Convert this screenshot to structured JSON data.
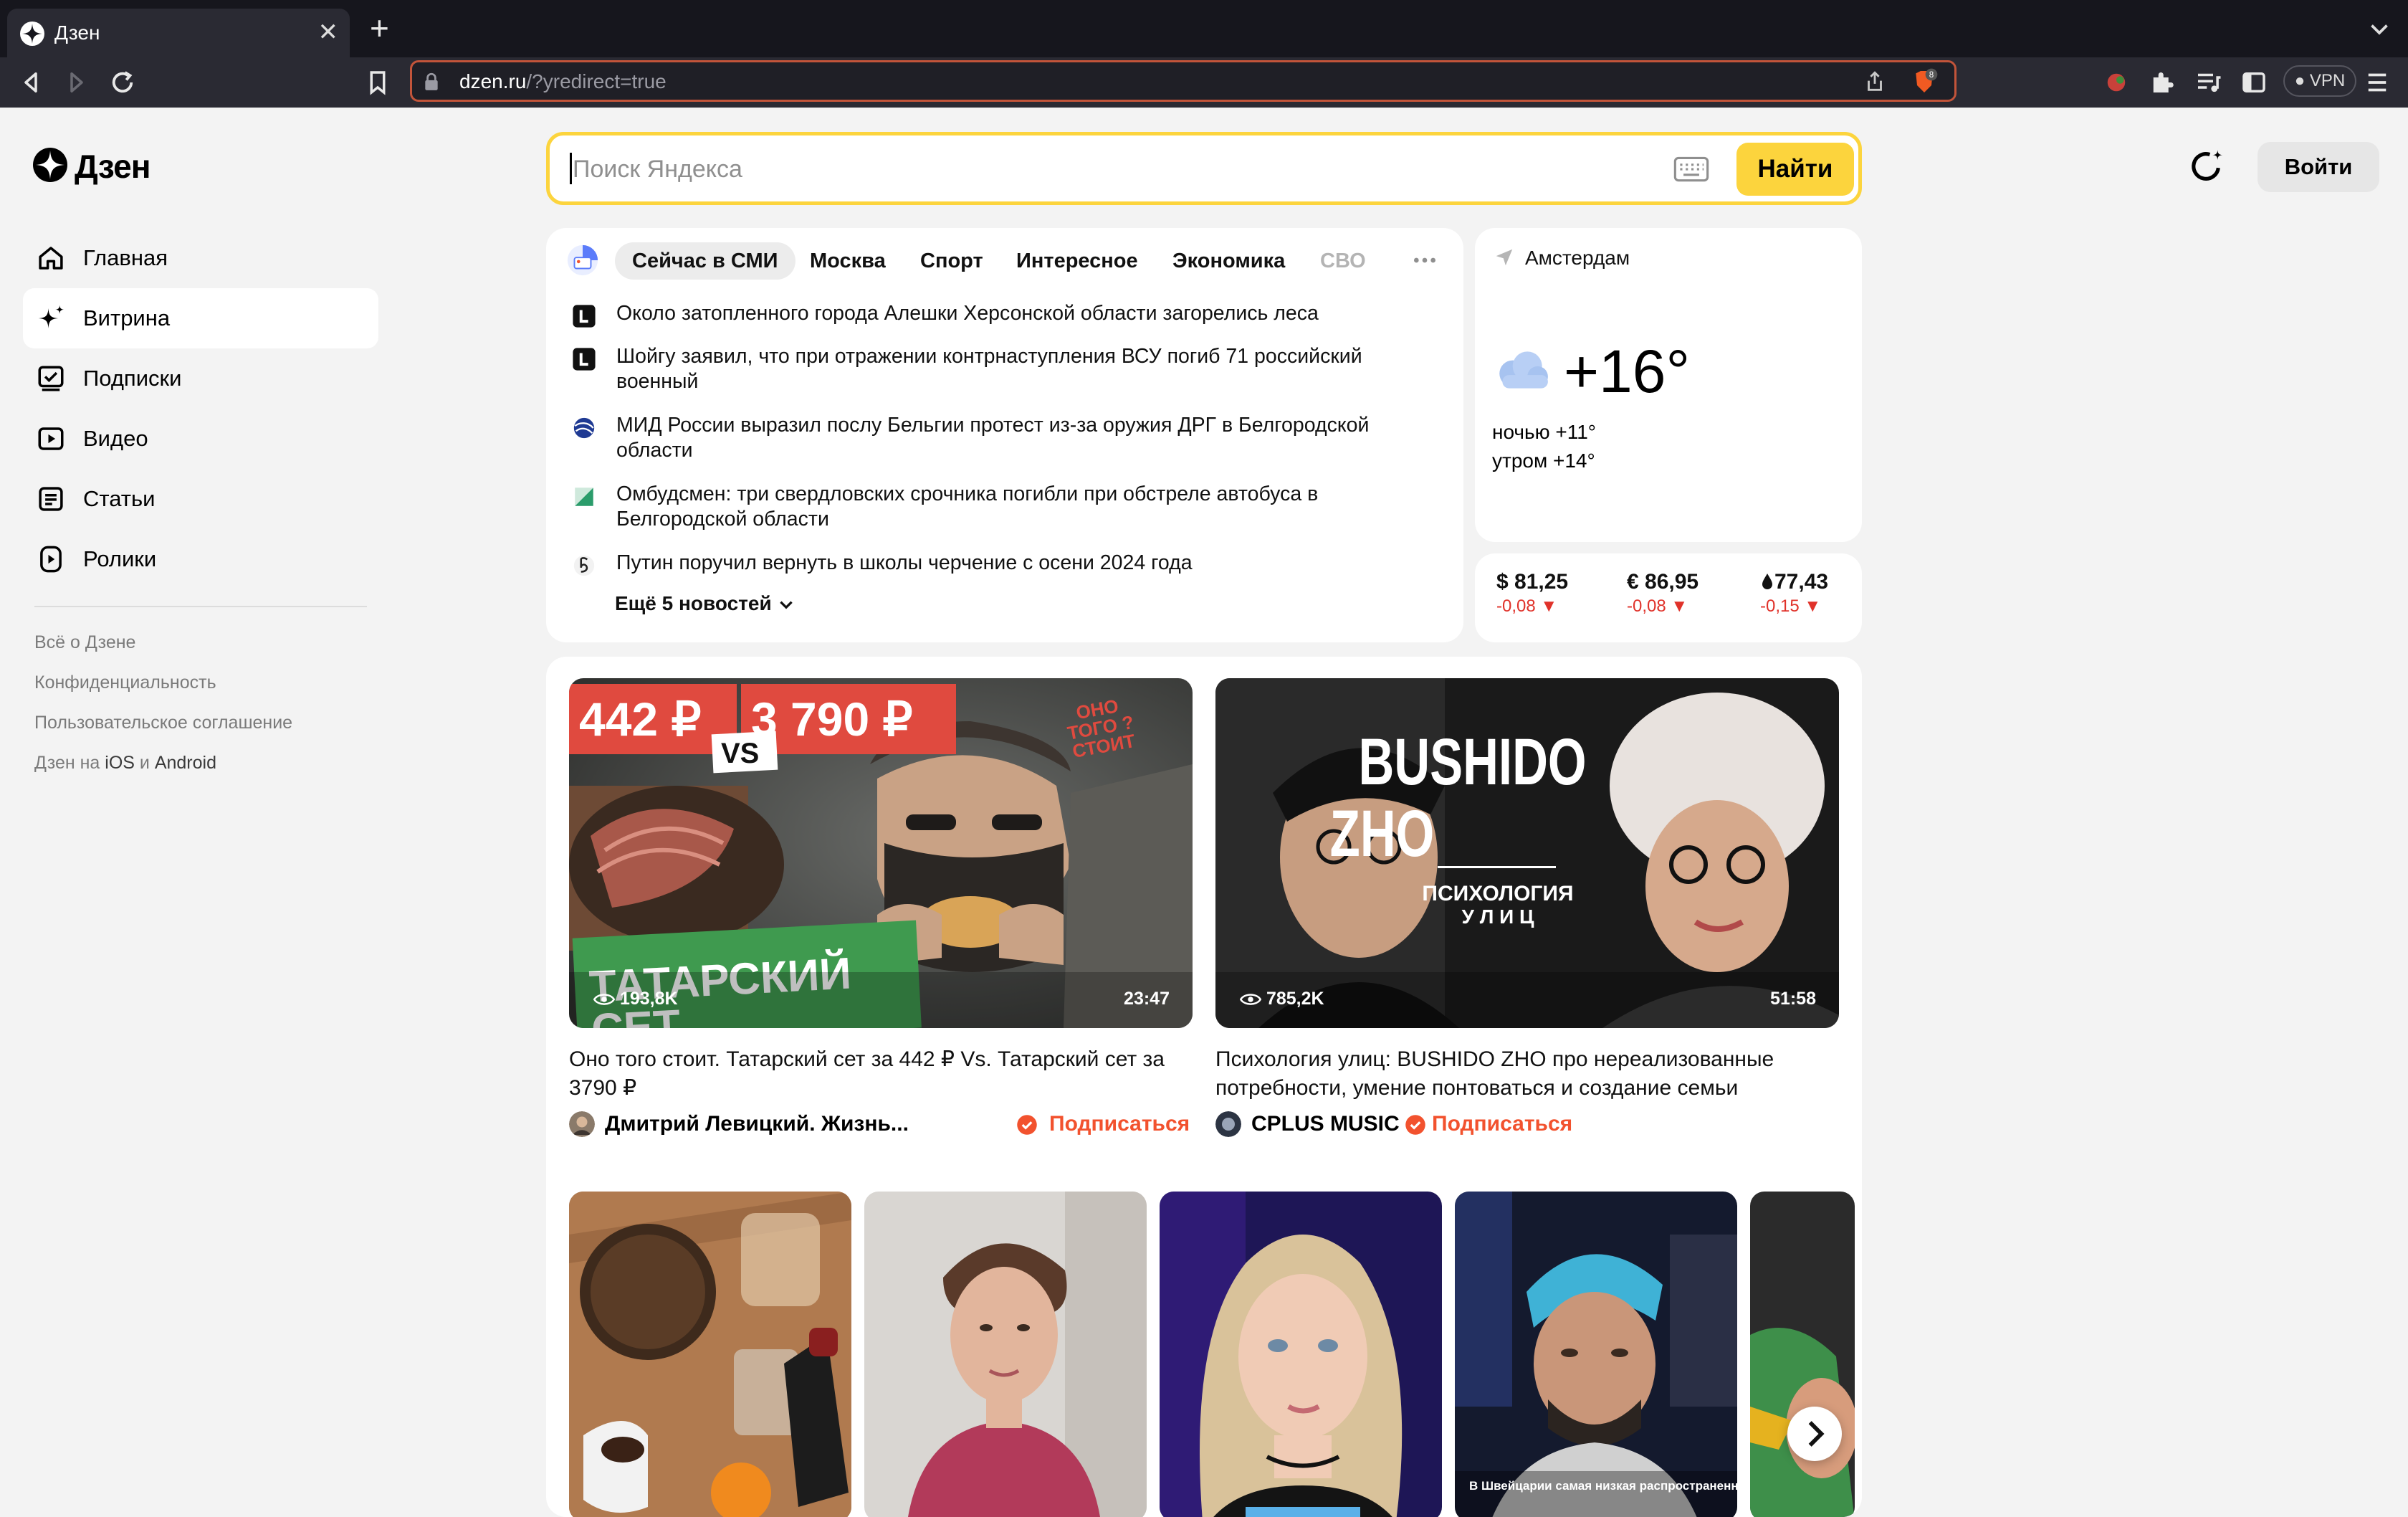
{
  "browser": {
    "tab_title": "Дзен",
    "url_domain": "dzen.ru",
    "url_path": "/?yredirect=true",
    "brave_count": "8",
    "vpn_label": "VPN"
  },
  "sidebar": {
    "logo_text": "Дзен",
    "items": [
      {
        "label": "Главная",
        "icon": "home-icon"
      },
      {
        "label": "Витрина",
        "icon": "sparkle-icon",
        "active": true
      },
      {
        "label": "Подписки",
        "icon": "subscriptions-icon"
      },
      {
        "label": "Видео",
        "icon": "video-icon"
      },
      {
        "label": "Статьи",
        "icon": "article-icon"
      },
      {
        "label": "Ролики",
        "icon": "clips-icon"
      }
    ],
    "footer": {
      "about": "Всё о Дзене",
      "privacy": "Конфиденциальность",
      "terms": "Пользовательское соглашение",
      "apps_prefix": "Дзен на ",
      "apps_ios": "iOS",
      "apps_and": " и ",
      "apps_android": "Android"
    }
  },
  "search": {
    "placeholder": "Поиск Яндекса",
    "button": "Найти"
  },
  "header": {
    "login": "Войти"
  },
  "news": {
    "tabs": [
      "Сейчас в СМИ",
      "Москва",
      "Спорт",
      "Интересное",
      "Экономика",
      "СВО"
    ],
    "items": [
      {
        "text": "Около затопленного города Алешки Херсонской области загорелись леса"
      },
      {
        "text": "Шойгу заявил, что при отражении контрнаступления ВСУ погиб 71 российский военный"
      },
      {
        "text": "МИД России выразил послу Бельгии протест из-за оружия ДРГ в Белгородской области"
      },
      {
        "text": "Омбудсмен: три свердловских срочника погибли при обстреле автобуса в Белгородской области"
      },
      {
        "text": "Путин поручил вернуть в школы черчение с осени 2024 года"
      }
    ],
    "more": "Ещё 5 новостей"
  },
  "weather": {
    "city": "Амстердам",
    "temp": "+16°",
    "night": "ночью +11°",
    "morning": "утром +14°"
  },
  "rates": [
    {
      "value": "$ 81,25",
      "delta": "-0,08 ▼"
    },
    {
      "value": "€ 86,95",
      "delta": "-0,08 ▼"
    },
    {
      "value": "77,43",
      "delta": "-0,15 ▼"
    }
  ],
  "feed": {
    "videos": [
      {
        "views": "193,8K",
        "duration": "23:47",
        "title": "Оно того стоит. Татарский сет за 442 ₽ Vs. Татарский сет за 3790 ₽",
        "author": "Дмитрий Левицкий. Жизнь...",
        "subscribe": "Подписаться",
        "thumb": {
          "price1": "442 ₽",
          "price2": "3 790 ₽",
          "vs": "VS",
          "badge1": "ОНО",
          "badge2": "ТОГО ?",
          "badge3": "СТОИТ",
          "banner1": "ТАТАРСКИЙ",
          "banner2": "СЕТ"
        }
      },
      {
        "views": "785,2K",
        "duration": "51:58",
        "title": "Психология улиц: BUSHIDO ZHO про нереализованные потребности, умение понтоваться и создание семьи",
        "author": "CPLUS MUSIC",
        "subscribe": "Подписаться",
        "thumb": {
          "line1": "BUSHIDO",
          "line2": "ZHO",
          "line3": "ПСИХОЛОГИЯ",
          "line4": "У Л И Ц"
        }
      }
    ],
    "shorts_caption": "В Швейцарии самая низкая распространенность"
  },
  "colors": {
    "accent": "#fcd43d",
    "subscribe": "#f2522e",
    "negative": "#e0322a"
  }
}
